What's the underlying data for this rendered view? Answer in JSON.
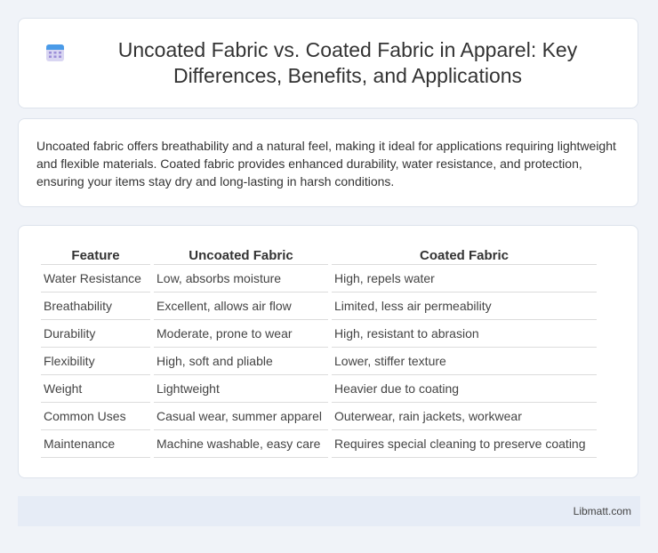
{
  "header": {
    "icon": "calendar-icon",
    "title": "Uncoated Fabric vs. Coated Fabric in Apparel: Key Differences, Benefits, and Applications"
  },
  "intro": {
    "text": "Uncoated fabric offers breathability and a natural feel, making it ideal for applications requiring lightweight and flexible materials. Coated fabric provides enhanced durability, water resistance, and protection, ensuring your items stay dry and long-lasting in harsh conditions."
  },
  "comparison": {
    "headers": [
      "Feature",
      "Uncoated Fabric",
      "Coated Fabric"
    ],
    "rows": [
      [
        "Water Resistance",
        "Low, absorbs moisture",
        "High, repels water"
      ],
      [
        "Breathability",
        "Excellent, allows air flow",
        "Limited, less air permeability"
      ],
      [
        "Durability",
        "Moderate, prone to wear",
        "High, resistant to abrasion"
      ],
      [
        "Flexibility",
        "High, soft and pliable",
        "Lower, stiffer texture"
      ],
      [
        "Weight",
        "Lightweight",
        "Heavier due to coating"
      ],
      [
        "Common Uses",
        "Casual wear, summer apparel",
        "Outerwear, rain jackets, workwear"
      ],
      [
        "Maintenance",
        "Machine washable, easy care",
        "Requires special cleaning to preserve coating"
      ]
    ]
  },
  "footer": {
    "site": "Libmatt.com"
  },
  "colors": {
    "background": "#f0f3f8",
    "card": "#ffffff",
    "footer": "#e6ecf6"
  }
}
